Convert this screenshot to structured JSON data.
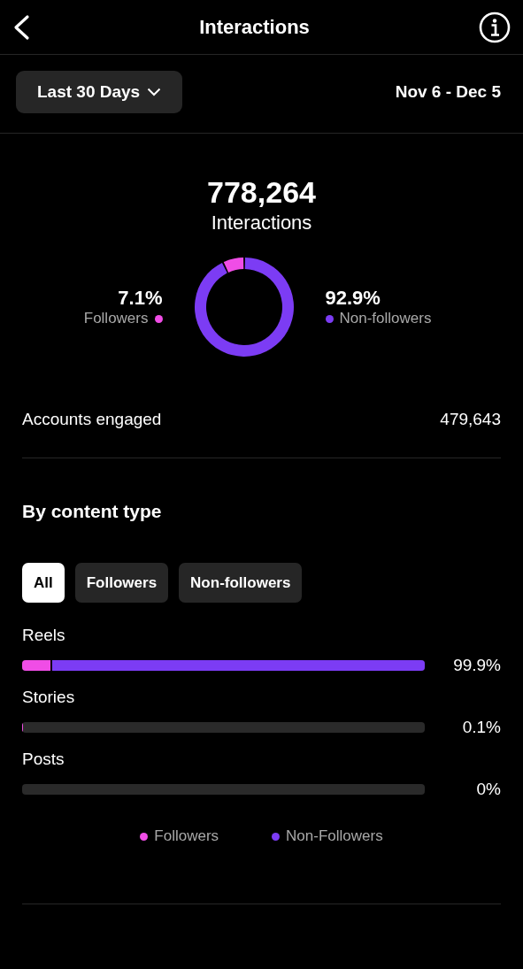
{
  "header": {
    "title": "Interactions"
  },
  "period": {
    "label": "Last 30 Days",
    "range": "Nov 6 - Dec 5"
  },
  "summary": {
    "total": "778,264",
    "caption": "Interactions",
    "split": [
      {
        "value": "7.1%",
        "label": "Followers",
        "color": "#f04de6"
      },
      {
        "value": "92.9%",
        "label": "Non-followers",
        "color": "#7c3cf4"
      }
    ]
  },
  "accounts_engaged": {
    "label": "Accounts engaged",
    "value": "479,643"
  },
  "content_type": {
    "title": "By content type",
    "filters": [
      {
        "label": "All",
        "selected": true
      },
      {
        "label": "Followers",
        "selected": false
      },
      {
        "label": "Non-followers",
        "selected": false
      }
    ],
    "rows": [
      {
        "name": "Reels",
        "segments": [
          {
            "kind": "followers",
            "level": 0.07
          },
          {
            "kind": "non_followers",
            "level": 0.929
          }
        ],
        "reading": "99.9%"
      },
      {
        "name": "Stories",
        "segments": [
          {
            "kind": "followers",
            "level": 0.002
          }
        ],
        "reading": "0.1%"
      },
      {
        "name": "Posts",
        "reading": "0%"
      }
    ],
    "legend": [
      {
        "label": "Followers",
        "color": "#f04de6"
      },
      {
        "label": "Non-Followers",
        "color": "#7c3cf4"
      }
    ]
  }
}
